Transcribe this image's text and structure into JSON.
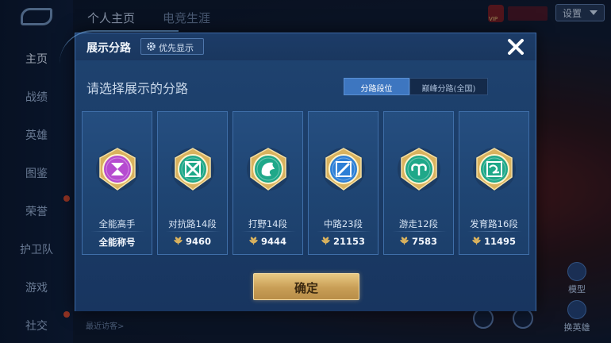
{
  "background": {
    "top_nav": [
      "个人主页",
      "电竞生涯"
    ],
    "sidebar": [
      "主页",
      "战绩",
      "英雄",
      "图鉴",
      "荣誉",
      "护卫队",
      "游戏",
      "社交"
    ],
    "settings_label": "设置",
    "right_buttons": [
      "模型",
      "换英雄"
    ],
    "recent_visitors": "最近访客>",
    "vip_text": "VIP"
  },
  "modal": {
    "title": "展示分路",
    "priority_label": "优先显示",
    "subtitle": "请选择展示的分路",
    "toggle": {
      "active": "分路段位",
      "inactive": "巅峰分路(全国)"
    },
    "cards": [
      {
        "label": "全能高手",
        "value": "全能称号",
        "emblem": "allround-emblem-icon",
        "color": "#b64bd0"
      },
      {
        "label": "对抗路14段",
        "value": "9460",
        "emblem": "clash-lane-emblem-icon",
        "color": "#1fa889"
      },
      {
        "label": "打野14段",
        "value": "9444",
        "emblem": "jungle-emblem-icon",
        "color": "#1fa889"
      },
      {
        "label": "中路23段",
        "value": "21153",
        "emblem": "mid-lane-emblem-icon",
        "color": "#2d7fd6"
      },
      {
        "label": "游走12段",
        "value": "7583",
        "emblem": "roam-emblem-icon",
        "color": "#1fa889"
      },
      {
        "label": "发育路16段",
        "value": "11495",
        "emblem": "farm-lane-emblem-icon",
        "color": "#1fa889"
      }
    ],
    "confirm_label": "确定"
  }
}
